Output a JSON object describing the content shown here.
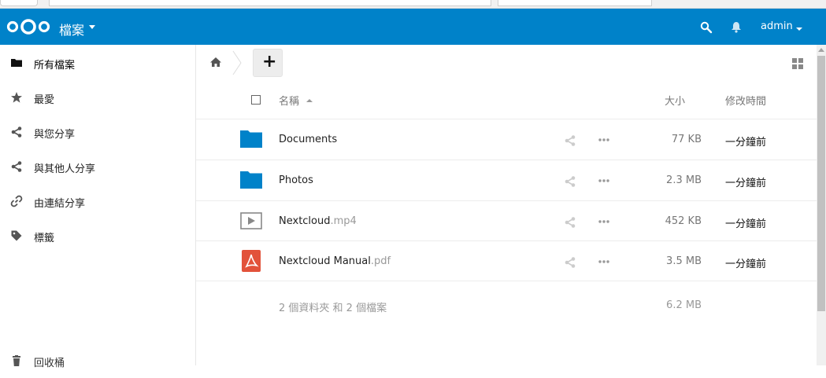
{
  "header": {
    "app_title": "檔案",
    "user": "admin",
    "brand_color": "#0082c9"
  },
  "sidebar": {
    "items": [
      {
        "label": "所有檔案",
        "icon": "folder-icon"
      },
      {
        "label": "最愛",
        "icon": "star-icon"
      },
      {
        "label": "與您分享",
        "icon": "share-icon"
      },
      {
        "label": "與其他人分享",
        "icon": "share-icon"
      },
      {
        "label": "由連結分享",
        "icon": "link-icon"
      },
      {
        "label": "標籤",
        "icon": "tag-icon"
      }
    ],
    "trash_label": "回收桶"
  },
  "toolbar": {
    "add_label": "+"
  },
  "table": {
    "headers": {
      "name": "名稱",
      "size": "大小",
      "modified": "修改時間"
    },
    "rows": [
      {
        "name": "Documents",
        "ext": "",
        "type": "folder",
        "size": "77 KB",
        "modified": "一分鐘前"
      },
      {
        "name": "Photos",
        "ext": "",
        "type": "folder",
        "size": "2.3 MB",
        "modified": "一分鐘前"
      },
      {
        "name": "Nextcloud",
        "ext": ".mp4",
        "type": "video",
        "size": "452 KB",
        "modified": "一分鐘前"
      },
      {
        "name": "Nextcloud Manual",
        "ext": ".pdf",
        "type": "pdf",
        "size": "3.5 MB",
        "modified": "一分鐘前"
      }
    ],
    "summary": {
      "text": "2 個資料夾 和 2 個檔案",
      "size": "6.2 MB"
    }
  }
}
